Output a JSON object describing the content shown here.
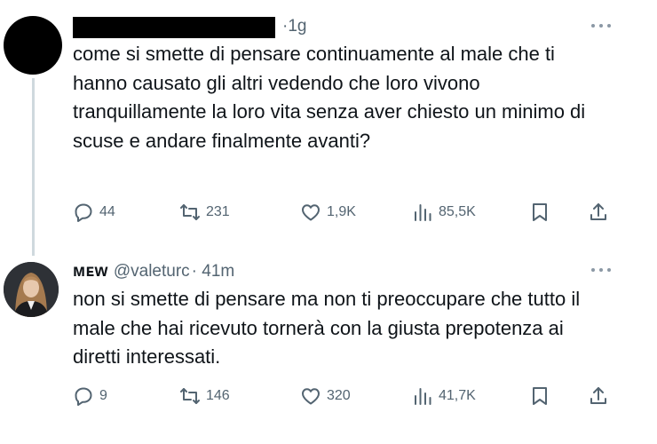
{
  "tweets": [
    {
      "time": "·1g",
      "text": "come si smette di pensare continuamente al male che ti hanno causato gli altri vedendo che loro vivono tranquillamente la loro vita senza aver chiesto un minimo di scuse e andare finalmente avanti?",
      "replies": "44",
      "retweets": "231",
      "likes": "1,9K",
      "views": "85,5K"
    },
    {
      "name": "ᴍᴇᴡ",
      "handle": "@valeturc",
      "time": "· 41m",
      "text": "non si smette di pensare ma non ti preoccupare che tutto il male che hai ricevuto tornerà con la giusta prepotenza ai diretti interessati.",
      "replies": "9",
      "retweets": "146",
      "likes": "320",
      "views": "41,7K"
    }
  ],
  "icons": {
    "reply": "reply-icon",
    "retweet": "retweet-icon",
    "like": "heart-icon",
    "views": "views-chart-icon",
    "bookmark": "bookmark-icon",
    "share": "share-icon",
    "more": "more-dots-icon"
  },
  "colors": {
    "text": "#0f1419",
    "muted": "#536471",
    "thread_line": "#cfd9de"
  }
}
